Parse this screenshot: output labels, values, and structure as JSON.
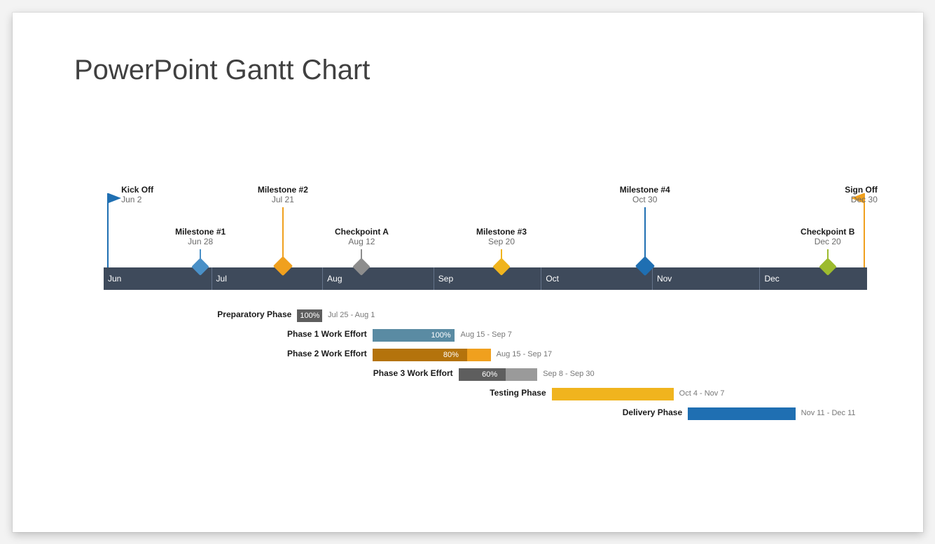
{
  "title": "PowerPoint Gantt Chart",
  "chart_data": {
    "type": "bar",
    "title": "PowerPoint Gantt Chart",
    "x_range": [
      "Jun 1",
      "Dec 31"
    ],
    "categories": [
      "Jun",
      "Jul",
      "Aug",
      "Sep",
      "Oct",
      "Nov",
      "Dec"
    ],
    "milestones": [
      {
        "name": "Kick Off",
        "date": "Jun 2",
        "marker": "flag",
        "color": "#1f6fb2",
        "tier": "high"
      },
      {
        "name": "Milestone #1",
        "date": "Jun 28",
        "marker": "diamond",
        "color": "#4a90c7",
        "tier": "low"
      },
      {
        "name": "Milestone #2",
        "date": "Jul 21",
        "marker": "diamond",
        "color": "#f0a01e",
        "tier": "high"
      },
      {
        "name": "Checkpoint A",
        "date": "Aug 12",
        "marker": "diamond",
        "color": "#8d8d8d",
        "tier": "low"
      },
      {
        "name": "Milestone #3",
        "date": "Sep 20",
        "marker": "diamond",
        "color": "#f0b41e",
        "tier": "low"
      },
      {
        "name": "Milestone #4",
        "date": "Oct 30",
        "marker": "diamond",
        "color": "#1f6fb2",
        "tier": "high"
      },
      {
        "name": "Checkpoint B",
        "date": "Dec 20",
        "marker": "diamond",
        "color": "#9dbb2f",
        "tier": "low"
      },
      {
        "name": "Sign Off",
        "date": "Dec 30",
        "marker": "flag",
        "color": "#f0a01e",
        "tier": "high"
      }
    ],
    "series": [
      {
        "name": "Preparatory Phase",
        "start": "Jul 25",
        "end": "Aug 1",
        "pct": 100,
        "fill": "#5e5e5e",
        "total": "#5e5e5e",
        "date_text": "Jul 25 - Aug 1"
      },
      {
        "name": "Phase 1 Work Effort",
        "start": "Aug 15",
        "end": "Sep 7",
        "pct": 100,
        "fill": "#5a8ba3",
        "total": "#5a8ba3",
        "date_text": "Aug 15 - Sep 7"
      },
      {
        "name": "Phase 2 Work Effort",
        "start": "Aug 15",
        "end": "Sep 17",
        "pct": 80,
        "fill": "#b4730c",
        "total": "#f0a01e",
        "date_text": "Aug 15 - Sep 17"
      },
      {
        "name": "Phase 3 Work Effort",
        "start": "Sep 8",
        "end": "Sep 30",
        "pct": 60,
        "fill": "#5e5e5e",
        "total": "#9a9a9a",
        "date_text": "Sep 8 - Sep 30"
      },
      {
        "name": "Testing Phase",
        "start": "Oct 4",
        "end": "Nov 7",
        "pct": 100,
        "fill": "#f0b41e",
        "total": "#f0b41e",
        "pct_hidden": true,
        "date_text": "Oct 4 - Nov 7"
      },
      {
        "name": "Delivery Phase",
        "start": "Nov 11",
        "end": "Dec 11",
        "pct": 100,
        "fill": "#1f6fb2",
        "total": "#1f6fb2",
        "pct_hidden": true,
        "date_text": "Nov 11 - Dec 11"
      }
    ]
  }
}
